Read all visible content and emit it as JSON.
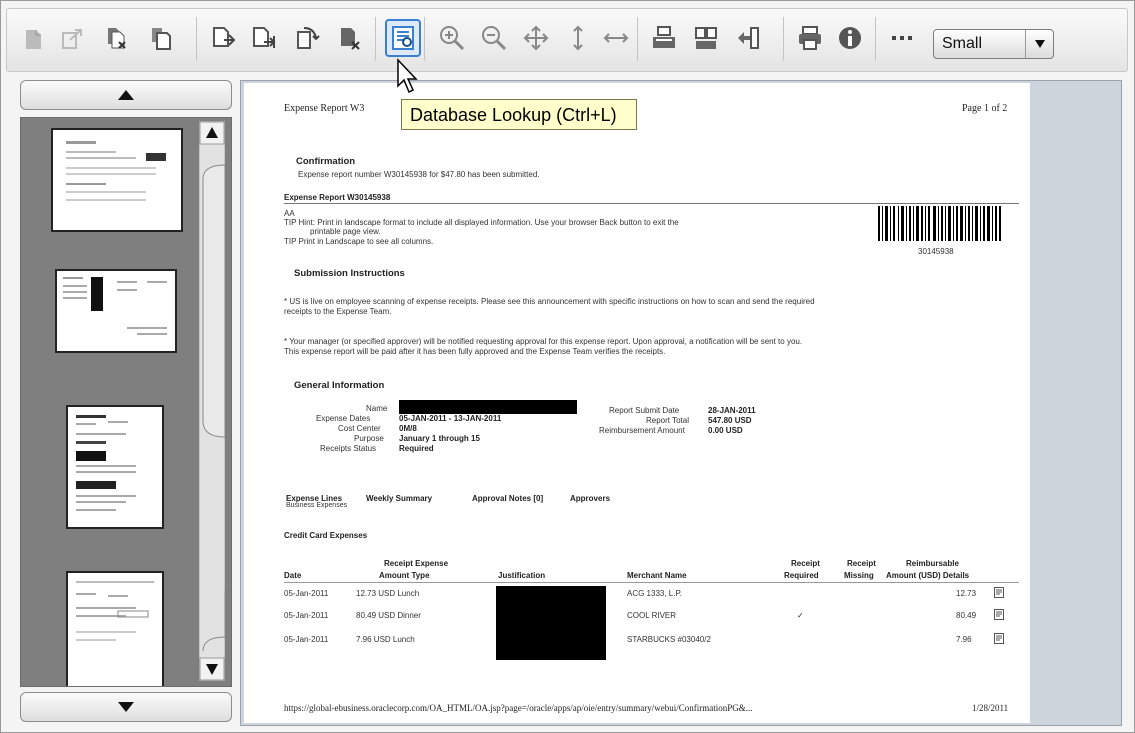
{
  "toolbar": {
    "buttons": [
      {
        "icon": "insert-page-icon"
      },
      {
        "icon": "export-page-icon"
      },
      {
        "icon": "delete-pages-icon"
      },
      {
        "icon": "copy-pages-icon"
      },
      {
        "icon": "extract-pages-icon"
      },
      {
        "icon": "split-pages-icon"
      },
      {
        "icon": "rotate-pages-icon"
      },
      {
        "icon": "remove-page-icon"
      },
      {
        "icon": "database-lookup-icon"
      },
      {
        "icon": "zoom-in-icon"
      },
      {
        "icon": "zoom-out-icon"
      },
      {
        "icon": "pan-icon"
      },
      {
        "icon": "fit-height-icon"
      },
      {
        "icon": "fit-width-icon"
      },
      {
        "icon": "scan-pages-icon"
      },
      {
        "icon": "merge-pages-icon"
      },
      {
        "icon": "reorder-pages-icon"
      },
      {
        "icon": "print-icon"
      },
      {
        "icon": "info-icon"
      },
      {
        "icon": "more-icon"
      }
    ],
    "thumbnail_size": "Small"
  },
  "tooltip": "Database Lookup (Ctrl+L)",
  "document": {
    "header_title": "Expense Report W3",
    "page_label": "Page 1 of 2",
    "confirmation_heading": "Confirmation",
    "confirmation_text": "Expense report number W30145938 for $47.80 has been submitted.",
    "report_heading": "Expense Report W30145938",
    "report_aa": "AA",
    "tip1": "TIP Hint: Print in landscape format to include all displayed information. Use your browser Back button to exit the",
    "tip1b": "printable page view.",
    "tip2": "TIP Print in Landscape to see all columns.",
    "barcode_number": "30145938",
    "submission_heading": "Submission Instructions",
    "sub1a": "* US is live on employee scanning of expense receipts. Please see this announcement with specific instructions on how to scan and send the required",
    "sub1b": "receipts to the Expense Team.",
    "sub2a": "* Your manager (or specified approver) will be notified requesting approval for this expense report. Upon approval, a notification will be sent to you.",
    "sub2b": "This expense report will be paid after it has been fully approved and the Expense Team verifies the receipts.",
    "general_heading": "General Information",
    "gi": {
      "name_label": "Name",
      "dates_label": "Expense Dates",
      "dates_value": "05-JAN-2011 - 13-JAN-2011",
      "cost_label": "Cost Center",
      "cost_value": "0M/8",
      "purpose_label": "Purpose",
      "purpose_value": "January 1 through 15",
      "receipts_label": "Receipts Status",
      "receipts_value": "Required",
      "submit_label": "Report Submit Date",
      "submit_value": "28-JAN-2011",
      "total_label": "Report Total",
      "total_value": "547.80 USD",
      "reimb_label": "Reimbursement Amount",
      "reimb_value": "0.00 USD"
    },
    "tabs": [
      "Expense Lines",
      "Weekly Summary",
      "Approval Notes [0]",
      "Approvers"
    ],
    "business_expenses": "Business Expenses",
    "credit_card_heading": "Credit Card Expenses",
    "columns": {
      "date": "Date",
      "receipt_amount": "Receipt Expense",
      "receipt_amount2": "Amount Type",
      "justification": "Justification",
      "merchant": "Merchant Name",
      "receipt_required": "Receipt",
      "receipt_required2": "Required",
      "receipt_missing": "Receipt",
      "receipt_missing2": "Missing",
      "reimbursable": "Reimbursable",
      "reimbursable2": "Amount (USD) Details"
    },
    "rows": [
      {
        "date": "05-Jan-2011",
        "amount": "12.73 USD Lunch",
        "merchant": "ACG 1333, L.P.",
        "required": "",
        "reimb": "12.73"
      },
      {
        "date": "05-Jan-2011",
        "amount": "80.49 USD Dinner",
        "merchant": "COOL RIVER",
        "required": "✓",
        "reimb": "80.49"
      },
      {
        "date": "05-Jan-2011",
        "amount": "7.96 USD Lunch",
        "merchant": "STARBUCKS #03040/2",
        "required": "",
        "reimb": "7.96"
      }
    ],
    "footer_url": "https://global-ebusiness.oraclecorp.com/OA_HTML/OA.jsp?page=/oracle/apps/ap/oie/entry/summary/webui/ConfirmationPG&...",
    "footer_date": "1/28/2011"
  }
}
